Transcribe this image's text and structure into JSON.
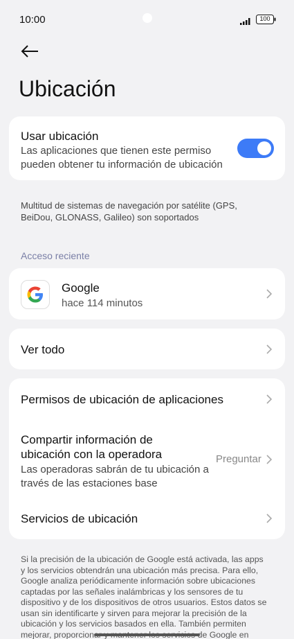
{
  "status_bar": {
    "time": "10:00",
    "battery": "100"
  },
  "page": {
    "title": "Ubicación"
  },
  "location_toggle": {
    "title": "Usar ubicación",
    "description": "Las aplicaciones que tienen este permiso pueden obtener tu información de ubicación",
    "enabled": true
  },
  "gnss_info": "Multitud de sistemas de navegación por satélite (GPS, BeiDou, GLONASS, Galileo) son soportados",
  "recent_access": {
    "label": "Acceso reciente",
    "apps": [
      {
        "name": "Google",
        "time": "hace 114 minutos",
        "icon": "google-icon"
      }
    ]
  },
  "see_all": "Ver todo",
  "settings": {
    "app_permissions": "Permisos de ubicación de aplicaciones",
    "carrier_title": "Compartir información de ubicación con la operadora",
    "carrier_description": "Las operadoras sabrán de tu ubicación a través de las estaciones base",
    "carrier_value": "Preguntar",
    "location_services": "Servicios de ubicación"
  },
  "footer": "Si la precisión de la ubicación de Google está activada, las apps y los servicios obtendrán una ubicación más precisa. Para ello, Google analiza periódicamente información sobre ubicaciones captadas por las señales inalámbricas y los sensores de tu dispositivo y de los dispositivos de otros usuarios. Estos datos se usan sin identificarte y sirven para mejorar la precisión de la ubicación y los servicios basados en ella. También permiten mejorar, proporcionar y mantener los servicios de Google en",
  "colors": {
    "accent": "#3d7bf7",
    "section_label": "#7a7fa6",
    "background": "#f2f2f4"
  }
}
